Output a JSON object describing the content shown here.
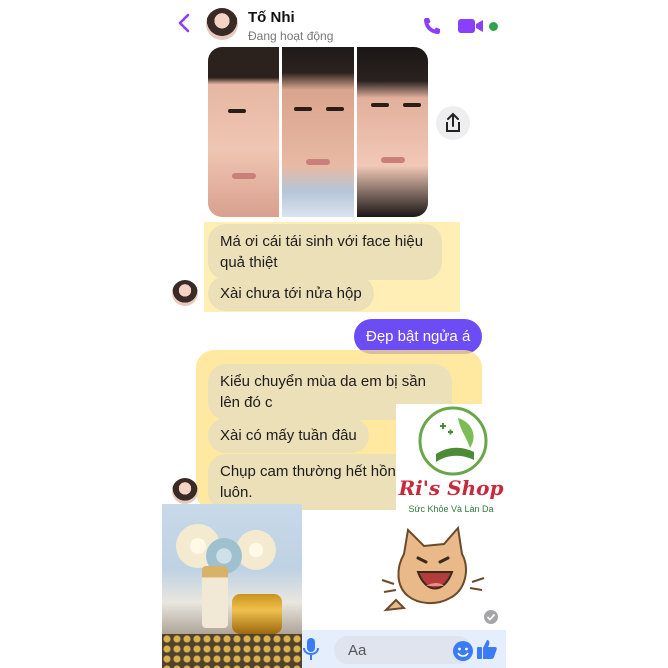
{
  "header": {
    "contact_name": "Tố Nhi",
    "status": "Đang hoạt động"
  },
  "messages": [
    {
      "from": "them",
      "text": "Má ơi cái tái sinh với face hiệu quả thiệt"
    },
    {
      "from": "them",
      "text": "Xài chưa tới nửa hộp"
    },
    {
      "from": "me",
      "text": "Đẹp bật ngửa á"
    },
    {
      "from": "them",
      "text": "Kiểu chuyển mùa da em bị sần lên đó c"
    },
    {
      "from": "them",
      "text": "Xài có mấy tuần đâu"
    },
    {
      "from": "them",
      "text": "Chụp cam thường hết hồn luôn."
    }
  ],
  "shop_logo": {
    "name": "Ri's Shop",
    "tagline": "Sức Khỏe Và Làn Da"
  },
  "composer": {
    "placeholder": "Aa"
  },
  "colors": {
    "accent": "#8a3ffc",
    "online": "#31a24c",
    "outgoing_bubble": "#6c4cf5",
    "highlight": "#ffe98c"
  },
  "icons": [
    "back-chevron-icon",
    "phone-icon",
    "video-camera-icon",
    "share-icon",
    "microphone-icon",
    "emoji-icon",
    "thumbs-up-icon",
    "seen-check-icon"
  ]
}
